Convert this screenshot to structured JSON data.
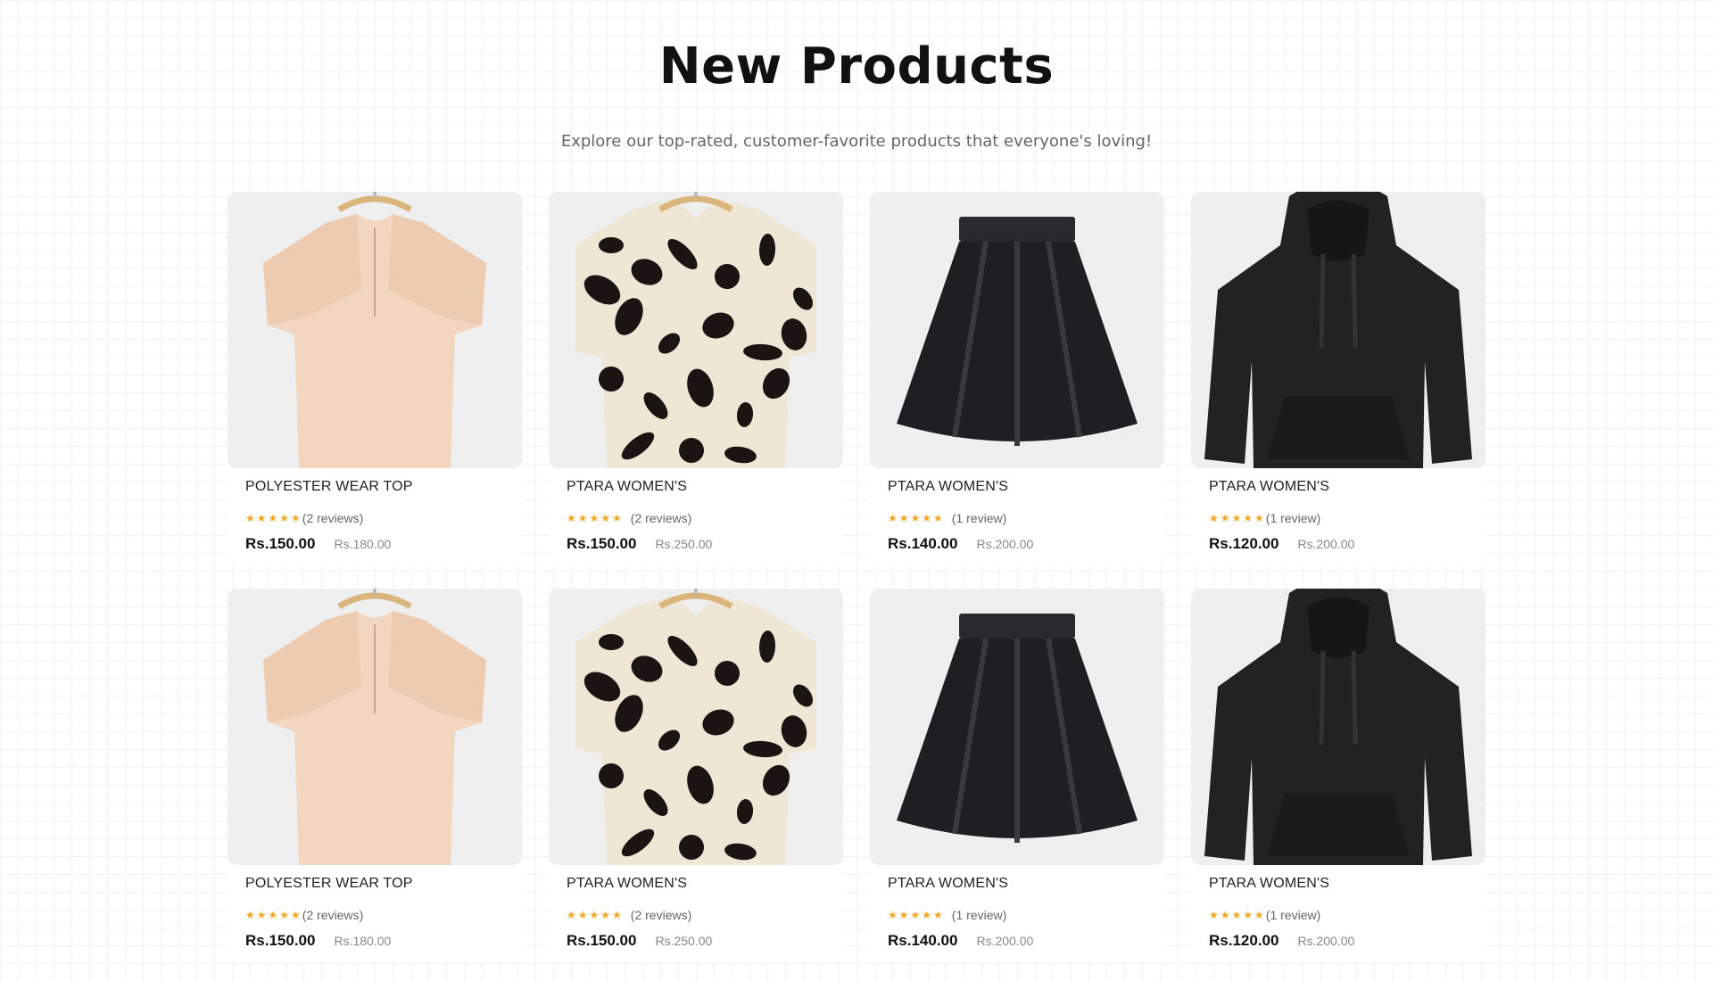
{
  "header": {
    "title": "New Products",
    "subtitle": "Explore our top-rated, customer-favorite products that everyone's loving!"
  },
  "products": [
    {
      "name": "POLYESTER WEAR TOP",
      "stars": "★★★★★",
      "reviews": "(2 reviews)",
      "price": "Rs.150.00",
      "old_price": "Rs.180.00",
      "image_icon": "blouse-icon",
      "spaced": false
    },
    {
      "name": "PTARA WOMEN'S",
      "stars": "★★★★★",
      "reviews": "(2 reviews)",
      "price": "Rs.150.00",
      "old_price": "Rs.250.00",
      "image_icon": "shirt-icon",
      "spaced": true
    },
    {
      "name": "PTARA WOMEN'S",
      "stars": "★★★★★",
      "reviews": "(1 review)",
      "price": "Rs.140.00",
      "old_price": "Rs.200.00",
      "image_icon": "skirt-icon",
      "spaced": true
    },
    {
      "name": "PTARA WOMEN'S",
      "stars": "★★★★★",
      "reviews": "(1 review)",
      "price": "Rs.120.00",
      "old_price": "Rs.200.00",
      "image_icon": "hoodie-icon",
      "spaced": false
    },
    {
      "name": "POLYESTER WEAR TOP",
      "stars": "★★★★★",
      "reviews": "(2 reviews)",
      "price": "Rs.150.00",
      "old_price": "Rs.180.00",
      "image_icon": "blouse-icon",
      "spaced": false
    },
    {
      "name": "PTARA WOMEN'S",
      "stars": "★★★★★",
      "reviews": "(2 reviews)",
      "price": "Rs.150.00",
      "old_price": "Rs.250.00",
      "image_icon": "shirt-icon",
      "spaced": true
    },
    {
      "name": "PTARA WOMEN'S",
      "stars": "★★★★★",
      "reviews": "(1 review)",
      "price": "Rs.140.00",
      "old_price": "Rs.200.00",
      "image_icon": "skirt-icon",
      "spaced": true
    },
    {
      "name": "PTARA WOMEN'S",
      "stars": "★★★★★",
      "reviews": "(1 review)",
      "price": "Rs.120.00",
      "old_price": "Rs.200.00",
      "image_icon": "hoodie-icon",
      "spaced": false
    }
  ],
  "colors": {
    "star": "#f5a623",
    "blouse": "#f3d6bf",
    "leopard_base": "#efe6d6",
    "leopard_spot": "#1b1412",
    "skirt": "#1f1f21",
    "hoodie": "#222222",
    "image_bg": "#efefef"
  }
}
